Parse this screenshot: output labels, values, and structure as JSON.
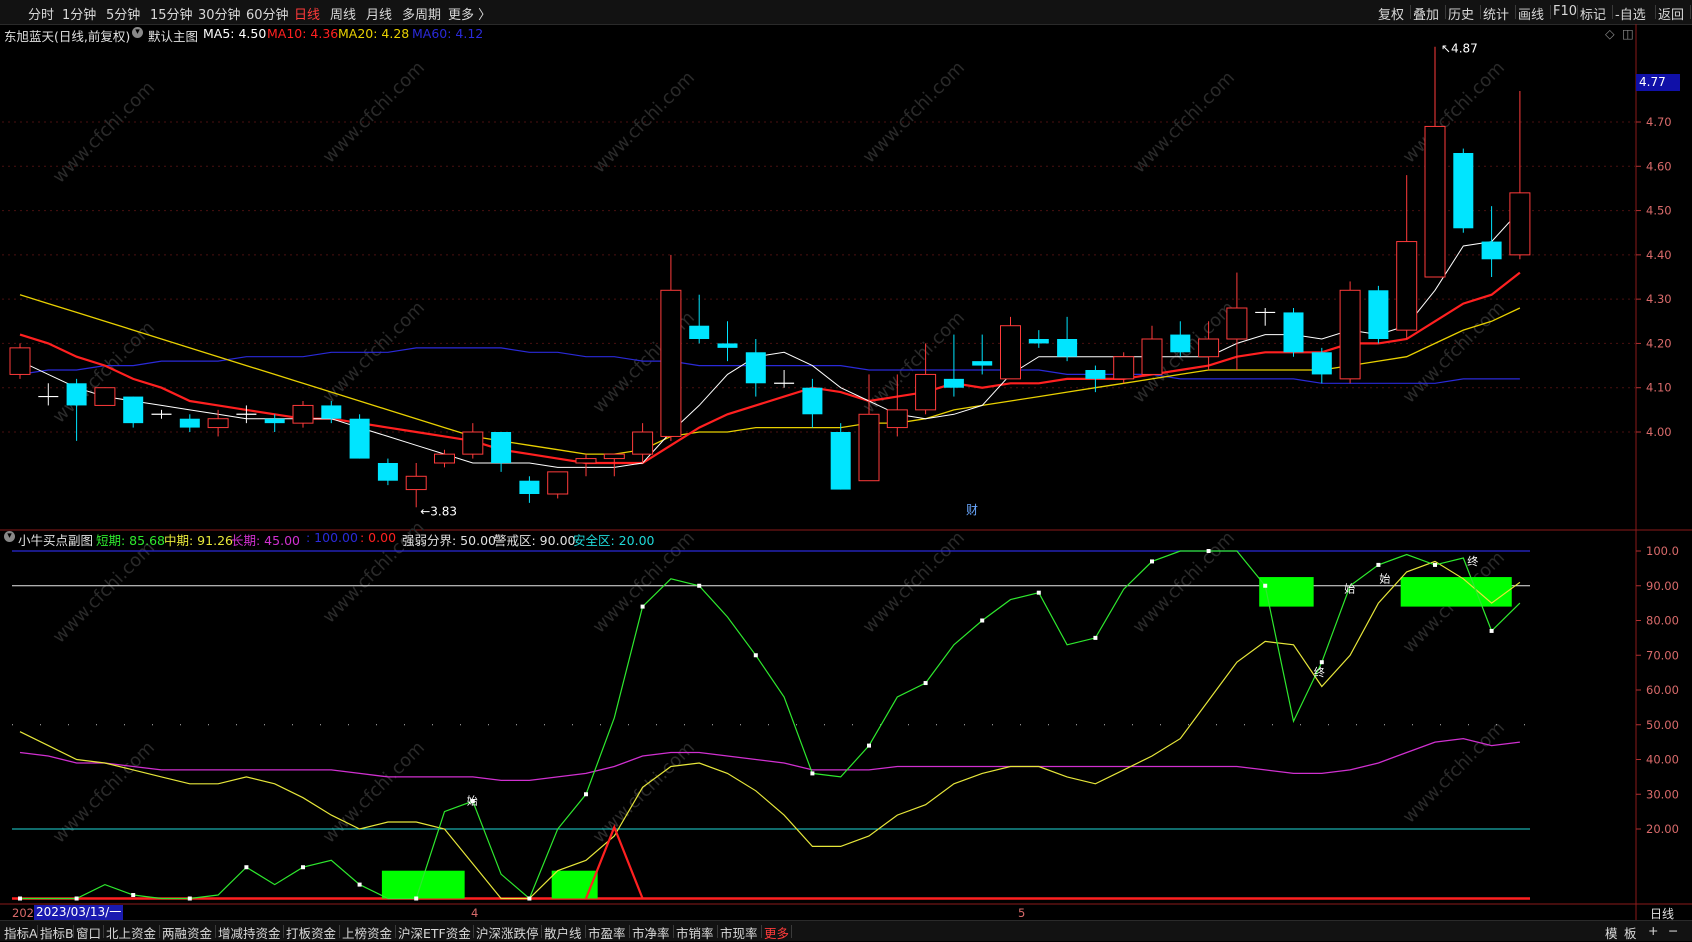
{
  "toolbar": {
    "periods": [
      "分时",
      "1分钟",
      "5分钟",
      "15分钟",
      "30分钟",
      "60分钟",
      "日线",
      "周线",
      "月线",
      "多周期",
      "更多 〉"
    ],
    "active_period": "日线",
    "right_items": [
      "复权",
      "叠加",
      "历史",
      "统计",
      "画线",
      "F10",
      "标记",
      "-自选",
      "返回"
    ]
  },
  "main": {
    "stock_title": "东旭蓝天(日线,前复权)",
    "chart_label": "默认主图",
    "ma5": "MA5: 4.50",
    "ma10": "MA10: 4.36",
    "ma20": "MA20: 4.28",
    "ma60": "MA60: 4.12",
    "high_marker": "4.87",
    "low_marker": "←3.83",
    "fin_marker": "财",
    "price_badge": "4.77",
    "y_labels": [
      "4.70",
      "4.60",
      "4.50",
      "4.40",
      "4.30",
      "4.20",
      "4.10",
      "4.00"
    ]
  },
  "sub": {
    "title": "小牛买点副图",
    "short": "短期: 85.68",
    "mid": "中期: 91.26",
    "long": "长期: 45.00",
    "hundred": ": 100.00",
    "zero": ": 0.00",
    "strong_weak": "强弱分界: 50.00",
    "warn": "警戒区: 90.00",
    "safe": "安全区: 20.00",
    "y_labels": [
      "100.0",
      "90.00",
      "80.00",
      "70.00",
      "60.00",
      "50.00",
      "40.00",
      "30.00",
      "20.00"
    ],
    "markers": [
      "始",
      "始",
      "终",
      "始",
      "终"
    ]
  },
  "xaxis": {
    "year_prefix": "202",
    "date_badge": "2023/03/13/一",
    "month_labels": [
      "4",
      "5"
    ],
    "period_tag": "日线"
  },
  "bottom_tabs": [
    "指标A",
    "指标B",
    "窗口",
    "北上资金",
    "两融资金",
    "增减持资金",
    "打板资金",
    "上榜资金",
    "沪深ETF资金",
    "沪深涨跌停",
    "散户线",
    "市盈率",
    "市净率",
    "市销率",
    "市现率",
    "更多"
  ],
  "bottom_right": [
    "模",
    "板",
    "+",
    "−"
  ],
  "watermark": "www.cfchi.com",
  "colors": {
    "up": "#ff3b3b",
    "down": "#00e5ff",
    "ma5": "#ffffff",
    "ma10": "#ff2020",
    "ma20": "#e8d000",
    "ma60": "#2a2ad8",
    "short": "#2ee82e",
    "mid": "#e6e63a",
    "long": "#d030d0",
    "green_box": "#00ff00"
  },
  "chart_data": {
    "type": "candlestick",
    "price_axis": [
      3.83,
      4.87
    ],
    "candles": [
      {
        "o": 4.13,
        "c": 4.19,
        "h": 4.2,
        "l": 4.12
      },
      {
        "o": 4.08,
        "c": 4.08,
        "h": 4.11,
        "l": 4.06
      },
      {
        "o": 4.11,
        "c": 4.06,
        "h": 4.12,
        "l": 3.98
      },
      {
        "o": 4.06,
        "c": 4.1,
        "h": 4.1,
        "l": 4.06
      },
      {
        "o": 4.08,
        "c": 4.02,
        "h": 4.08,
        "l": 4.01
      },
      {
        "o": 4.04,
        "c": 4.04,
        "h": 4.05,
        "l": 4.03
      },
      {
        "o": 4.03,
        "c": 4.01,
        "h": 4.04,
        "l": 4.0
      },
      {
        "o": 4.01,
        "c": 4.03,
        "h": 4.05,
        "l": 3.99
      },
      {
        "o": 4.04,
        "c": 4.04,
        "h": 4.06,
        "l": 4.02
      },
      {
        "o": 4.03,
        "c": 4.02,
        "h": 4.04,
        "l": 4.0
      },
      {
        "o": 4.02,
        "c": 4.06,
        "h": 4.07,
        "l": 4.01
      },
      {
        "o": 4.06,
        "c": 4.03,
        "h": 4.07,
        "l": 4.02
      },
      {
        "o": 4.03,
        "c": 3.94,
        "h": 4.04,
        "l": 3.94
      },
      {
        "o": 3.93,
        "c": 3.89,
        "h": 3.94,
        "l": 3.88
      },
      {
        "o": 3.87,
        "c": 3.9,
        "h": 3.93,
        "l": 3.83
      },
      {
        "o": 3.93,
        "c": 3.95,
        "h": 3.96,
        "l": 3.92
      },
      {
        "o": 3.95,
        "c": 4.0,
        "h": 4.02,
        "l": 3.94
      },
      {
        "o": 4.0,
        "c": 3.93,
        "h": 4.0,
        "l": 3.91
      },
      {
        "o": 3.89,
        "c": 3.86,
        "h": 3.9,
        "l": 3.84
      },
      {
        "o": 3.86,
        "c": 3.91,
        "h": 3.91,
        "l": 3.85
      },
      {
        "o": 3.93,
        "c": 3.94,
        "h": 3.95,
        "l": 3.9
      },
      {
        "o": 3.94,
        "c": 3.95,
        "h": 3.95,
        "l": 3.9
      },
      {
        "o": 3.95,
        "c": 4.0,
        "h": 4.02,
        "l": 3.93
      },
      {
        "o": 3.99,
        "c": 4.32,
        "h": 4.4,
        "l": 3.98
      },
      {
        "o": 4.24,
        "c": 4.21,
        "h": 4.31,
        "l": 4.2
      },
      {
        "o": 4.2,
        "c": 4.19,
        "h": 4.25,
        "l": 4.16
      },
      {
        "o": 4.18,
        "c": 4.11,
        "h": 4.21,
        "l": 4.08
      },
      {
        "o": 4.11,
        "c": 4.11,
        "h": 4.14,
        "l": 4.1
      },
      {
        "o": 4.1,
        "c": 4.04,
        "h": 4.12,
        "l": 4.01
      },
      {
        "o": 4.0,
        "c": 3.87,
        "h": 4.02,
        "l": 3.87
      },
      {
        "o": 3.89,
        "c": 4.04,
        "h": 4.13,
        "l": 3.89
      },
      {
        "o": 4.01,
        "c": 4.05,
        "h": 4.13,
        "l": 3.99
      },
      {
        "o": 4.05,
        "c": 4.13,
        "h": 4.2,
        "l": 4.04
      },
      {
        "o": 4.12,
        "c": 4.1,
        "h": 4.22,
        "l": 4.08
      },
      {
        "o": 4.16,
        "c": 4.15,
        "h": 4.22,
        "l": 4.13
      },
      {
        "o": 4.12,
        "c": 4.24,
        "h": 4.26,
        "l": 4.12
      },
      {
        "o": 4.21,
        "c": 4.2,
        "h": 4.23,
        "l": 4.19
      },
      {
        "o": 4.21,
        "c": 4.17,
        "h": 4.26,
        "l": 4.16
      },
      {
        "o": 4.14,
        "c": 4.12,
        "h": 4.15,
        "l": 4.09
      },
      {
        "o": 4.12,
        "c": 4.17,
        "h": 4.18,
        "l": 4.11
      },
      {
        "o": 4.13,
        "c": 4.21,
        "h": 4.24,
        "l": 4.13
      },
      {
        "o": 4.22,
        "c": 4.18,
        "h": 4.25,
        "l": 4.17
      },
      {
        "o": 4.17,
        "c": 4.21,
        "h": 4.25,
        "l": 4.14
      },
      {
        "o": 4.21,
        "c": 4.28,
        "h": 4.36,
        "l": 4.14
      },
      {
        "o": 4.27,
        "c": 4.27,
        "h": 4.28,
        "l": 4.24
      },
      {
        "o": 4.27,
        "c": 4.18,
        "h": 4.28,
        "l": 4.17
      },
      {
        "o": 4.18,
        "c": 4.13,
        "h": 4.19,
        "l": 4.11
      },
      {
        "o": 4.12,
        "c": 4.32,
        "h": 4.34,
        "l": 4.11
      },
      {
        "o": 4.32,
        "c": 4.21,
        "h": 4.33,
        "l": 4.2
      },
      {
        "o": 4.23,
        "c": 4.43,
        "h": 4.58,
        "l": 4.21
      },
      {
        "o": 4.35,
        "c": 4.69,
        "h": 4.87,
        "l": 4.35
      },
      {
        "o": 4.63,
        "c": 4.46,
        "h": 4.64,
        "l": 4.45
      },
      {
        "o": 4.43,
        "c": 4.39,
        "h": 4.51,
        "l": 4.35
      },
      {
        "o": 4.4,
        "c": 4.54,
        "h": 4.77,
        "l": 4.39
      }
    ],
    "ma5": [
      4.16,
      4.13,
      4.1,
      4.08,
      4.07,
      4.06,
      4.05,
      4.04,
      4.03,
      4.03,
      4.03,
      4.03,
      4.01,
      3.99,
      3.97,
      3.95,
      3.93,
      3.93,
      3.93,
      3.92,
      3.92,
      3.92,
      3.93,
      4.0,
      4.06,
      4.13,
      4.17,
      4.18,
      4.15,
      4.1,
      4.07,
      4.04,
      4.03,
      4.04,
      4.06,
      4.13,
      4.17,
      4.17,
      4.17,
      4.17,
      4.17,
      4.17,
      4.17,
      4.2,
      4.22,
      4.22,
      4.21,
      4.23,
      4.22,
      4.24,
      4.32,
      4.42,
      4.43,
      4.5
    ],
    "ma10": [
      4.22,
      4.2,
      4.17,
      4.15,
      4.12,
      4.1,
      4.07,
      4.06,
      4.05,
      4.04,
      4.03,
      4.03,
      4.02,
      4.01,
      4.0,
      3.99,
      3.98,
      3.96,
      3.95,
      3.94,
      3.93,
      3.93,
      3.93,
      3.97,
      4.01,
      4.04,
      4.06,
      4.08,
      4.1,
      4.09,
      4.07,
      4.08,
      4.09,
      4.11,
      4.1,
      4.11,
      4.11,
      4.12,
      4.12,
      4.12,
      4.13,
      4.14,
      4.15,
      4.17,
      4.18,
      4.18,
      4.18,
      4.2,
      4.2,
      4.21,
      4.25,
      4.29,
      4.31,
      4.36
    ],
    "ma20": [
      4.31,
      4.29,
      4.27,
      4.25,
      4.23,
      4.21,
      4.19,
      4.17,
      4.15,
      4.13,
      4.11,
      4.09,
      4.07,
      4.05,
      4.03,
      4.01,
      3.99,
      3.98,
      3.97,
      3.96,
      3.95,
      3.95,
      3.96,
      3.99,
      4.0,
      4.0,
      4.01,
      4.01,
      4.01,
      4.01,
      4.02,
      4.02,
      4.03,
      4.05,
      4.06,
      4.07,
      4.08,
      4.09,
      4.1,
      4.11,
      4.12,
      4.13,
      4.14,
      4.14,
      4.14,
      4.14,
      4.14,
      4.15,
      4.16,
      4.17,
      4.2,
      4.23,
      4.25,
      4.28
    ],
    "ma60": [
      4.13,
      4.14,
      4.14,
      4.15,
      4.15,
      4.16,
      4.16,
      4.16,
      4.17,
      4.17,
      4.17,
      4.18,
      4.18,
      4.18,
      4.19,
      4.19,
      4.19,
      4.19,
      4.18,
      4.18,
      4.17,
      4.17,
      4.16,
      4.16,
      4.15,
      4.15,
      4.15,
      4.15,
      4.15,
      4.15,
      4.14,
      4.14,
      4.14,
      4.14,
      4.14,
      4.14,
      4.14,
      4.13,
      4.13,
      4.13,
      4.13,
      4.12,
      4.12,
      4.12,
      4.12,
      4.12,
      4.11,
      4.11,
      4.11,
      4.11,
      4.11,
      4.12,
      4.12,
      4.12
    ],
    "short": [
      0,
      0,
      0,
      4,
      1,
      0,
      0,
      1,
      9,
      4,
      9,
      11,
      4,
      0,
      0,
      25,
      28,
      7,
      0,
      20,
      30,
      52,
      84,
      92,
      90,
      81,
      70,
      58,
      36,
      35,
      44,
      58,
      62,
      73,
      80,
      86,
      88,
      73,
      75,
      89,
      97,
      100,
      100,
      100,
      90,
      51,
      68,
      90,
      96,
      99,
      96,
      98,
      77,
      85
    ],
    "mid": [
      48,
      44,
      40,
      39,
      37,
      35,
      33,
      33,
      35,
      33,
      29,
      24,
      20,
      22,
      22,
      20,
      10,
      0,
      0,
      8,
      11,
      18,
      32,
      38,
      39,
      36,
      31,
      24,
      15,
      15,
      18,
      24,
      27,
      33,
      36,
      38,
      38,
      35,
      33,
      37,
      41,
      46,
      57,
      68,
      74,
      73,
      61,
      70,
      85,
      94,
      97,
      92,
      85,
      91
    ],
    "long": [
      42,
      41,
      39,
      39,
      38,
      37,
      37,
      37,
      37,
      37,
      37,
      37,
      36,
      35,
      35,
      35,
      35,
      34,
      34,
      35,
      36,
      38,
      41,
      42,
      42,
      41,
      40,
      39,
      37,
      37,
      37,
      38,
      38,
      38,
      38,
      38,
      38,
      38,
      38,
      38,
      38,
      38,
      38,
      38,
      37,
      36,
      36,
      37,
      39,
      42,
      45,
      46,
      44,
      45
    ]
  }
}
